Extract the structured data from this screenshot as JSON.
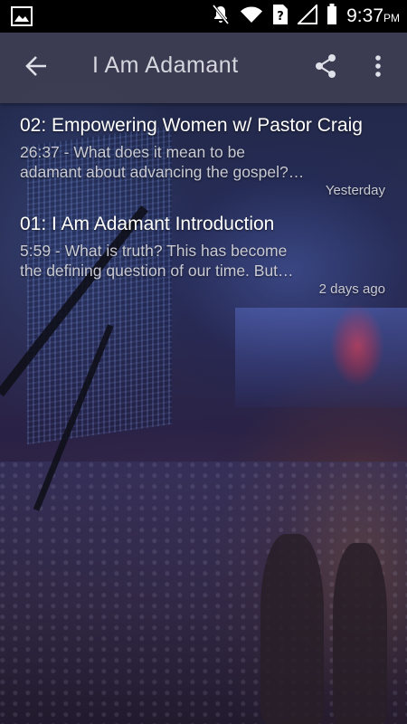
{
  "status_bar": {
    "time": "9:37",
    "ampm": "PM",
    "icons": [
      "image-icon",
      "mute-icon",
      "wifi-icon",
      "sim-unknown-icon",
      "signal-icon",
      "battery-icon"
    ]
  },
  "toolbar": {
    "title": "I Am Adamant",
    "back_icon": "arrow-back-icon",
    "share_icon": "share-icon",
    "overflow_icon": "more-vert-icon"
  },
  "episodes": [
    {
      "title": "02: Empowering Women w/ Pastor Craig",
      "desc_line1": "26:37 - What does it mean to be",
      "desc_line2": "adamant about advancing the gospel?…",
      "date": "Yesterday"
    },
    {
      "title": "01: I Am Adamant Introduction",
      "desc_line1": "5:59 - What is truth? This has become",
      "desc_line2": "the defining question of our time. But…",
      "date": "2 days ago"
    }
  ],
  "colors": {
    "toolbar_bg": "#3e3e52",
    "title_text": "#ffffff",
    "secondary_text": "#c9cad3",
    "status_bar_bg": "#000000"
  }
}
